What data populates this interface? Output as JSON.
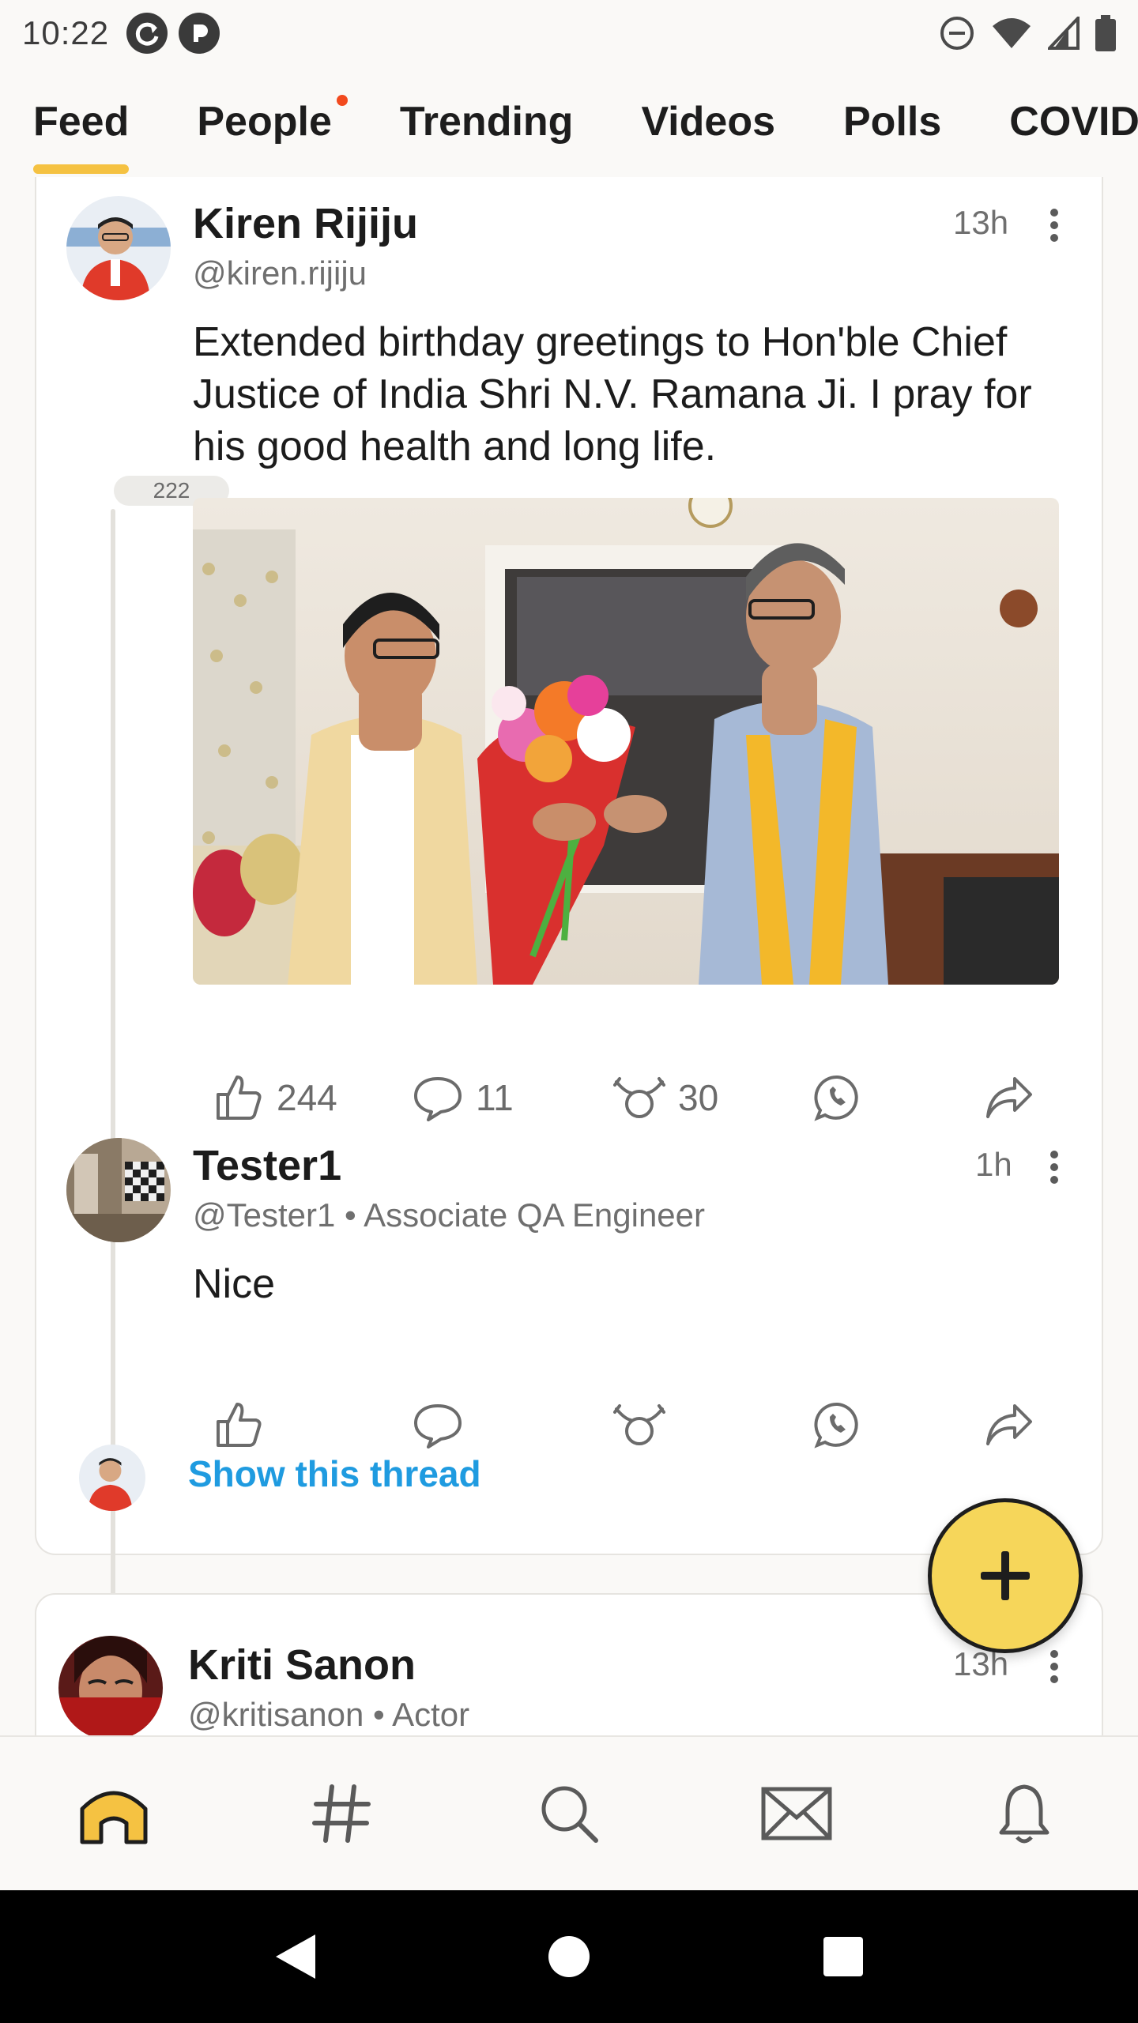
{
  "status_bar": {
    "time": "10:22",
    "app_icons": [
      "refresh-app-icon",
      "shield-app-icon"
    ],
    "system_icons": [
      "do-not-disturb-icon",
      "wifi-icon",
      "signal-icon",
      "battery-icon"
    ]
  },
  "tabs": [
    {
      "label": "Feed",
      "active": true
    },
    {
      "label": "People",
      "notification_dot": true
    },
    {
      "label": "Trending"
    },
    {
      "label": "Videos"
    },
    {
      "label": "Polls"
    },
    {
      "label": "COVID"
    }
  ],
  "posts": [
    {
      "author": "Kiren Rijiju",
      "handle": "@kiren.rijiju",
      "time": "13h",
      "badge": "222",
      "text": "Extended birthday greetings to Hon'ble Chief Justice of India Shri N.V. Ramana Ji. I pray for his good health and long life.",
      "image_description": "two men exchanging a bouquet",
      "likes": "244",
      "comments": "11",
      "rekoos": "30"
    },
    {
      "author": "Tester1",
      "handle": "@Tester1 • Associate QA Engineer",
      "time": "1h",
      "text": "Nice"
    }
  ],
  "thread_link": "Show this thread",
  "next_post": {
    "author": "Kriti Sanon",
    "handle": "@kritisanon • Actor",
    "time": "13h"
  },
  "colors": {
    "accent": "#f5c242",
    "fab": "#f6d65a",
    "link": "#1f9be0",
    "notification": "#f24a1e"
  }
}
